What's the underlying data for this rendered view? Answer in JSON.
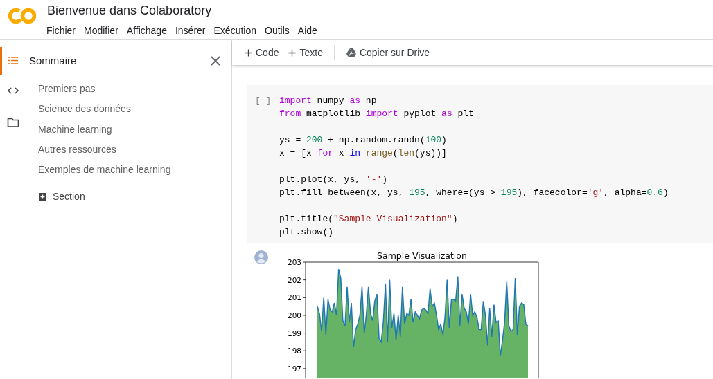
{
  "header": {
    "title": "Bienvenue dans Colaboratory",
    "menu": [
      "Fichier",
      "Modifier",
      "Affichage",
      "Insérer",
      "Exécution",
      "Outils",
      "Aide"
    ]
  },
  "rail": [
    {
      "kind": "toc",
      "selected": true
    },
    {
      "kind": "code",
      "selected": false
    },
    {
      "kind": "files",
      "selected": false
    }
  ],
  "sidebar": {
    "title": "Sommaire",
    "items": [
      "Premiers pas",
      "Science des données",
      "Machine learning",
      "Autres ressources",
      "Exemples de machine learning"
    ],
    "add_section": "Section"
  },
  "toolbar": {
    "add_code": "Code",
    "add_text": "Texte",
    "copy": "Copier sur Drive"
  },
  "cell": {
    "prompt": "[ ]",
    "blocks": [
      [
        [
          {
            "text": "import",
            "kind": "keyword"
          },
          {
            "text": " numpy ",
            "kind": "plain"
          },
          {
            "text": "as",
            "kind": "keyword"
          },
          {
            "text": " np",
            "kind": "plain"
          }
        ],
        [
          {
            "text": "from",
            "kind": "keyword"
          },
          {
            "text": " matplotlib ",
            "kind": "plain"
          },
          {
            "text": "import",
            "kind": "keyword"
          },
          {
            "text": " pyplot ",
            "kind": "plain"
          },
          {
            "text": "as",
            "kind": "keyword"
          },
          {
            "text": " plt",
            "kind": "plain"
          }
        ]
      ],
      [
        [
          {
            "text": "ys = ",
            "kind": "plain"
          },
          {
            "text": "200",
            "kind": "number"
          },
          {
            "text": " + np.random.randn(",
            "kind": "plain"
          },
          {
            "text": "100",
            "kind": "number"
          },
          {
            "text": ")",
            "kind": "plain"
          }
        ],
        [
          {
            "text": "x = [x ",
            "kind": "plain"
          },
          {
            "text": "for",
            "kind": "keyword"
          },
          {
            "text": " x ",
            "kind": "plain"
          },
          {
            "text": "in ",
            "kind": "operator"
          },
          {
            "text": "range",
            "kind": "builtin"
          },
          {
            "text": "(",
            "kind": "plain"
          },
          {
            "text": "len",
            "kind": "builtin"
          },
          {
            "text": "(ys))]",
            "kind": "plain"
          }
        ]
      ],
      [
        [
          {
            "text": "plt.plot(x, ys, ",
            "kind": "plain"
          },
          {
            "text": "'-'",
            "kind": "string"
          },
          {
            "text": ")",
            "kind": "plain"
          }
        ],
        [
          {
            "text": "plt.fill_between(x, ys, ",
            "kind": "plain"
          },
          {
            "text": "195",
            "kind": "number"
          },
          {
            "text": ", where=(ys > ",
            "kind": "plain"
          },
          {
            "text": "195",
            "kind": "number"
          },
          {
            "text": "), facecolor=",
            "kind": "plain"
          },
          {
            "text": "'g'",
            "kind": "string"
          },
          {
            "text": ", alpha=",
            "kind": "plain"
          },
          {
            "text": "0.6",
            "kind": "number"
          },
          {
            "text": ")",
            "kind": "plain"
          }
        ]
      ],
      [
        [
          {
            "text": "plt.title(",
            "kind": "plain"
          },
          {
            "text": "\"Sample Visualization\"",
            "kind": "string"
          },
          {
            "text": ")",
            "kind": "plain"
          }
        ],
        [
          {
            "text": "plt.show()",
            "kind": "plain"
          }
        ]
      ]
    ]
  },
  "output": {
    "chart_data": {
      "type": "line",
      "title": "Sample Visualization",
      "ylim": [
        196.45,
        203
      ],
      "yticks": [
        197,
        198,
        199,
        200,
        201,
        202,
        203
      ],
      "series": [
        {
          "type": "area",
          "color": "#008000",
          "values": [
            200.5,
            200.1,
            199.1,
            201.0,
            198.9,
            200.9,
            200.3,
            200.2,
            200.7,
            200.0,
            202.6,
            202.1,
            199.7,
            199.4,
            201.6,
            199.6,
            200.7,
            198.2,
            199.2,
            199.5,
            200.0,
            201.6,
            199.0,
            200.0,
            201.6,
            200.1,
            199.7,
            200.8,
            201.2,
            198.7,
            198.5,
            199.6,
            201.8,
            198.5,
            202.0,
            199.3,
            200.1,
            198.6,
            200.0,
            198.8,
            201.6,
            199.5,
            200.1,
            200.0,
            200.9,
            199.6,
            200.2,
            200.0,
            199.8,
            200.3,
            200.4,
            200.3,
            200.1,
            201.5,
            200.5,
            200.7,
            200.0,
            199.2,
            199.5,
            198.9,
            199.9,
            202.0,
            199.3,
            200.9,
            200.9,
            200.8,
            202.2,
            199.4,
            201.2,
            200.4,
            200.2,
            199.5,
            201.2,
            200.0,
            200.2,
            199.9,
            199.2,
            199.2,
            200.8,
            200.0,
            198.3,
            200.4,
            198.8,
            200.6,
            199.6,
            199.7,
            197.7,
            198.6,
            199.6,
            201.9,
            199.4,
            199.1,
            199.2,
            202.1,
            198.9,
            200.5,
            200.7,
            200.6,
            199.5,
            199.4
          ]
        },
        {
          "color": "#1f77b4",
          "values": [
            200.5,
            200.1,
            199.1,
            201.0,
            198.9,
            200.9,
            200.3,
            200.2,
            200.7,
            200.0,
            202.6,
            202.1,
            199.7,
            199.4,
            201.6,
            199.6,
            200.7,
            198.2,
            199.2,
            199.5,
            200.0,
            201.6,
            199.0,
            200.0,
            201.6,
            200.1,
            199.7,
            200.8,
            201.2,
            198.7,
            198.5,
            199.6,
            201.8,
            198.5,
            202.0,
            199.3,
            200.1,
            198.6,
            200.0,
            198.8,
            201.6,
            199.5,
            200.1,
            200.0,
            200.9,
            199.6,
            200.2,
            200.0,
            199.8,
            200.3,
            200.4,
            200.3,
            200.1,
            201.5,
            200.5,
            200.7,
            200.0,
            199.2,
            199.5,
            198.9,
            199.9,
            202.0,
            199.3,
            200.9,
            200.9,
            200.8,
            202.2,
            199.4,
            201.2,
            200.4,
            200.2,
            199.5,
            201.2,
            200.0,
            200.2,
            199.9,
            199.2,
            199.2,
            200.8,
            200.0,
            198.3,
            200.4,
            198.8,
            200.6,
            199.6,
            199.7,
            197.7,
            198.6,
            199.6,
            201.9,
            199.4,
            199.1,
            199.2,
            202.1,
            198.9,
            200.5,
            200.7,
            200.6,
            199.5,
            199.4
          ]
        }
      ]
    }
  }
}
